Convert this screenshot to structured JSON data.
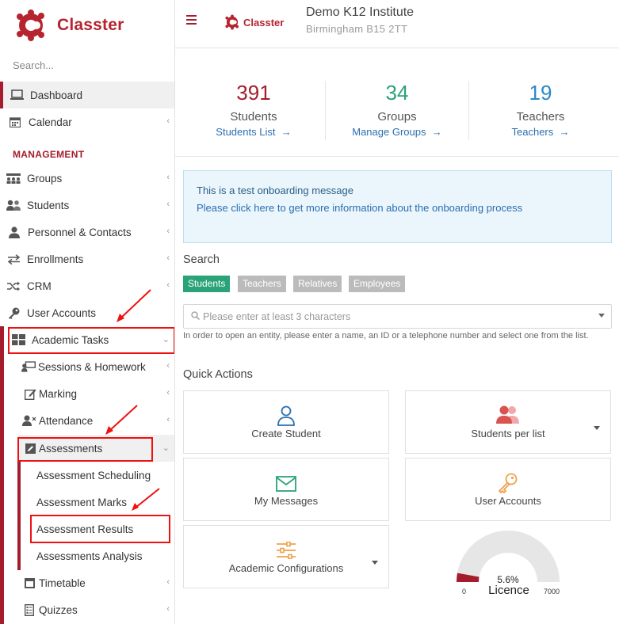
{
  "brand": {
    "name": "Classter",
    "color": "#b5242f"
  },
  "header": {
    "institute_name": "Demo K12 Institute",
    "institute_address": "Birmingham B15 2TT"
  },
  "sidebar": {
    "search_placeholder": "Search...",
    "section_label": "MANAGEMENT",
    "items": [
      {
        "label": "Dashboard",
        "icon": "laptop-icon"
      },
      {
        "label": "Calendar",
        "icon": "calendar-icon"
      },
      {
        "label": "Groups",
        "icon": "groups-icon"
      },
      {
        "label": "Students",
        "icon": "students-icon"
      },
      {
        "label": "Personnel & Contacts",
        "icon": "person-icon"
      },
      {
        "label": "Enrollments",
        "icon": "exchange-icon"
      },
      {
        "label": "CRM",
        "icon": "random-icon"
      },
      {
        "label": "User Accounts",
        "icon": "key-icon"
      },
      {
        "label": "Academic Tasks",
        "icon": "grid-icon"
      }
    ],
    "academic_tasks": [
      {
        "label": "Sessions & Homework",
        "icon": "teacher-icon"
      },
      {
        "label": "Marking",
        "icon": "edit-icon"
      },
      {
        "label": "Attendance",
        "icon": "attendance-icon"
      },
      {
        "label": "Assessments",
        "icon": "pencil-square-icon"
      }
    ],
    "assessments": [
      {
        "label": "Assessment Scheduling"
      },
      {
        "label": "Assessment Marks"
      },
      {
        "label": "Assessment Results"
      },
      {
        "label": "Assessments Analysis"
      }
    ],
    "more": [
      {
        "label": "Timetable",
        "icon": "calendar-icon"
      },
      {
        "label": "Quizzes",
        "icon": "quiz-icon"
      }
    ]
  },
  "stats": [
    {
      "number": "391",
      "label": "Students",
      "link": "Students List",
      "color": "#a51d2d"
    },
    {
      "number": "34",
      "label": "Groups",
      "link": "Manage Groups",
      "color": "#2aa378"
    },
    {
      "number": "19",
      "label": "Teachers",
      "link": "Teachers",
      "color": "#2a8ac8"
    }
  ],
  "onboarding": {
    "line1": "This is a test onboarding message",
    "line2": "Please click here to get more information about the onboarding process"
  },
  "search": {
    "title": "Search",
    "tabs": [
      "Students",
      "Teachers",
      "Relatives",
      "Employees"
    ],
    "selected_tab": "Students",
    "placeholder": "Please enter at least 3 characters",
    "help": "In order to open an entity, please enter a name, an ID or a telephone number and select one from the list."
  },
  "quick_actions": {
    "title": "Quick Actions",
    "items": [
      {
        "label": "Create Student",
        "icon": "user-add-icon",
        "color": "#2a6fb0"
      },
      {
        "label": "Students per list",
        "icon": "users-icon",
        "color": "#d9534f"
      },
      {
        "label": "My Messages",
        "icon": "envelope-icon",
        "color": "#2aa378"
      },
      {
        "label": "User Accounts",
        "icon": "key-icon",
        "color": "#f0a04b"
      },
      {
        "label": "Academic Configurations",
        "icon": "sliders-icon",
        "color": "#f0a04b"
      }
    ]
  },
  "licence": {
    "percent_label": "5.6%",
    "percent": 5.6,
    "label": "Licence",
    "min": "0",
    "max": "7000"
  }
}
